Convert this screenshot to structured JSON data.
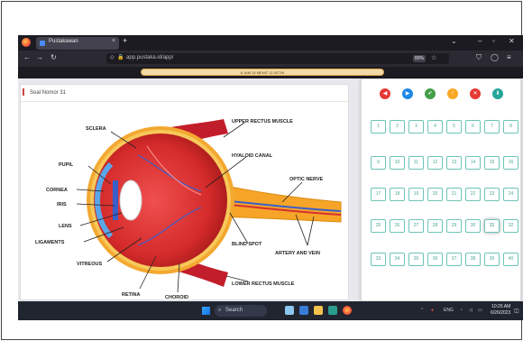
{
  "browser": {
    "tab_title": "Pustakawan",
    "url": "app.pustaka.id/app/",
    "zoom": "80%",
    "notification": "6 JAM 15 MENIT 11 DETIK"
  },
  "question": {
    "title": "Soal Nomor 31"
  },
  "diagram_labels": {
    "sclera": "SCLERA",
    "pupil": "PUPIL",
    "cornea": "CORNEA",
    "iris": "IRIS",
    "lens": "LENS",
    "ligaments": "LIGAMENTS",
    "vitreous": "VITREOUS",
    "retina": "RETINA",
    "choroid": "CHOROID",
    "upper_rectus": "UPPER RECTUS MUSCLE",
    "hyaloid": "HYALOID CANAL",
    "optic_nerve": "OPTIC NERVE",
    "blind_spot": "BLIND SPOT",
    "artery_vein": "ARTERY AND VEIN",
    "lower_rectus": "LOWER RECTUS MUSCLE"
  },
  "nav_buttons": [
    {
      "name": "prev",
      "color": "#e53935",
      "glyph": "◀"
    },
    {
      "name": "next",
      "color": "#1e88e5",
      "glyph": "▶"
    },
    {
      "name": "check",
      "color": "#43a047",
      "glyph": "✔"
    },
    {
      "name": "flag",
      "color": "#f9a825",
      "glyph": "!"
    },
    {
      "name": "close",
      "color": "#e53935",
      "glyph": "✕"
    },
    {
      "name": "finish",
      "color": "#26a69a",
      "glyph": "⬇"
    }
  ],
  "question_numbers": [
    "1",
    "2",
    "3",
    "4",
    "5",
    "6",
    "7",
    "8",
    "9",
    "10",
    "11",
    "12",
    "13",
    "14",
    "15",
    "16",
    "17",
    "18",
    "19",
    "20",
    "21",
    "22",
    "23",
    "24",
    "25",
    "26",
    "27",
    "28",
    "29",
    "30",
    "31",
    "32",
    "33",
    "34",
    "35",
    "36",
    "37",
    "38",
    "39",
    "40"
  ],
  "active_number": "31",
  "taskbar": {
    "search": "Search",
    "lang": "ENG",
    "time": "10:25 AM",
    "date": "6/26/2023"
  }
}
